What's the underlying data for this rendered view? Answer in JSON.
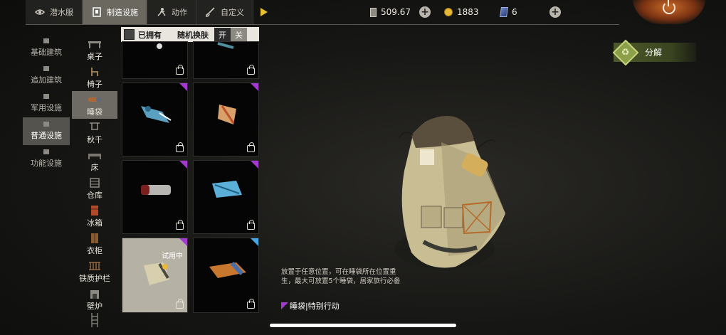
{
  "tabs": [
    {
      "label": "潜水服",
      "icon": "diving-suit-icon",
      "active": false
    },
    {
      "label": "制造设施",
      "icon": "facility-icon",
      "active": true
    },
    {
      "label": "动作",
      "icon": "action-icon",
      "active": false
    },
    {
      "label": "自定义",
      "icon": "brush-icon",
      "active": false
    }
  ],
  "resources": {
    "card_value": "509.67",
    "coins": "1883",
    "tickets": "6"
  },
  "categories": [
    {
      "label": "基础建筑",
      "active": false
    },
    {
      "label": "追加建筑",
      "active": false
    },
    {
      "label": "军用设施",
      "active": false
    },
    {
      "label": "普通设施",
      "active": true
    },
    {
      "label": "功能设施",
      "active": false
    }
  ],
  "item_types": [
    {
      "label": "桌子",
      "active": false
    },
    {
      "label": "椅子",
      "active": false
    },
    {
      "label": "睡袋",
      "active": true
    },
    {
      "label": "秋千",
      "active": false
    },
    {
      "label": "床",
      "active": false
    },
    {
      "label": "仓库",
      "active": false
    },
    {
      "label": "冰箱",
      "active": false
    },
    {
      "label": "衣柜",
      "active": false
    },
    {
      "label": "铁质护栏",
      "active": false
    },
    {
      "label": "壁炉",
      "active": false
    }
  ],
  "filter": {
    "owned_label": "已拥有",
    "random_skin_label": "随机换肤",
    "on_label": "开",
    "off_label": "关"
  },
  "grid_items": [
    {
      "rarity": "none",
      "locked": true
    },
    {
      "rarity": "none",
      "locked": true
    },
    {
      "rarity": "purple",
      "locked": true
    },
    {
      "rarity": "purple",
      "locked": true
    },
    {
      "rarity": "purple",
      "locked": true
    },
    {
      "rarity": "purple",
      "locked": true
    },
    {
      "rarity": "purple",
      "locked": true,
      "selected": true,
      "badge": "试用中"
    },
    {
      "rarity": "blue",
      "locked": true
    }
  ],
  "decompose_label": "分解",
  "description": "放置于任意位置，可在睡袋所在位置重生，最大可放置5个睡袋，居家旅行必备",
  "tagline": "睡袋|特别行动",
  "colors": {
    "purple": "#a23ad0",
    "blue": "#4aa4e0",
    "gold": "#e6c02e",
    "green": "#8ba048"
  }
}
